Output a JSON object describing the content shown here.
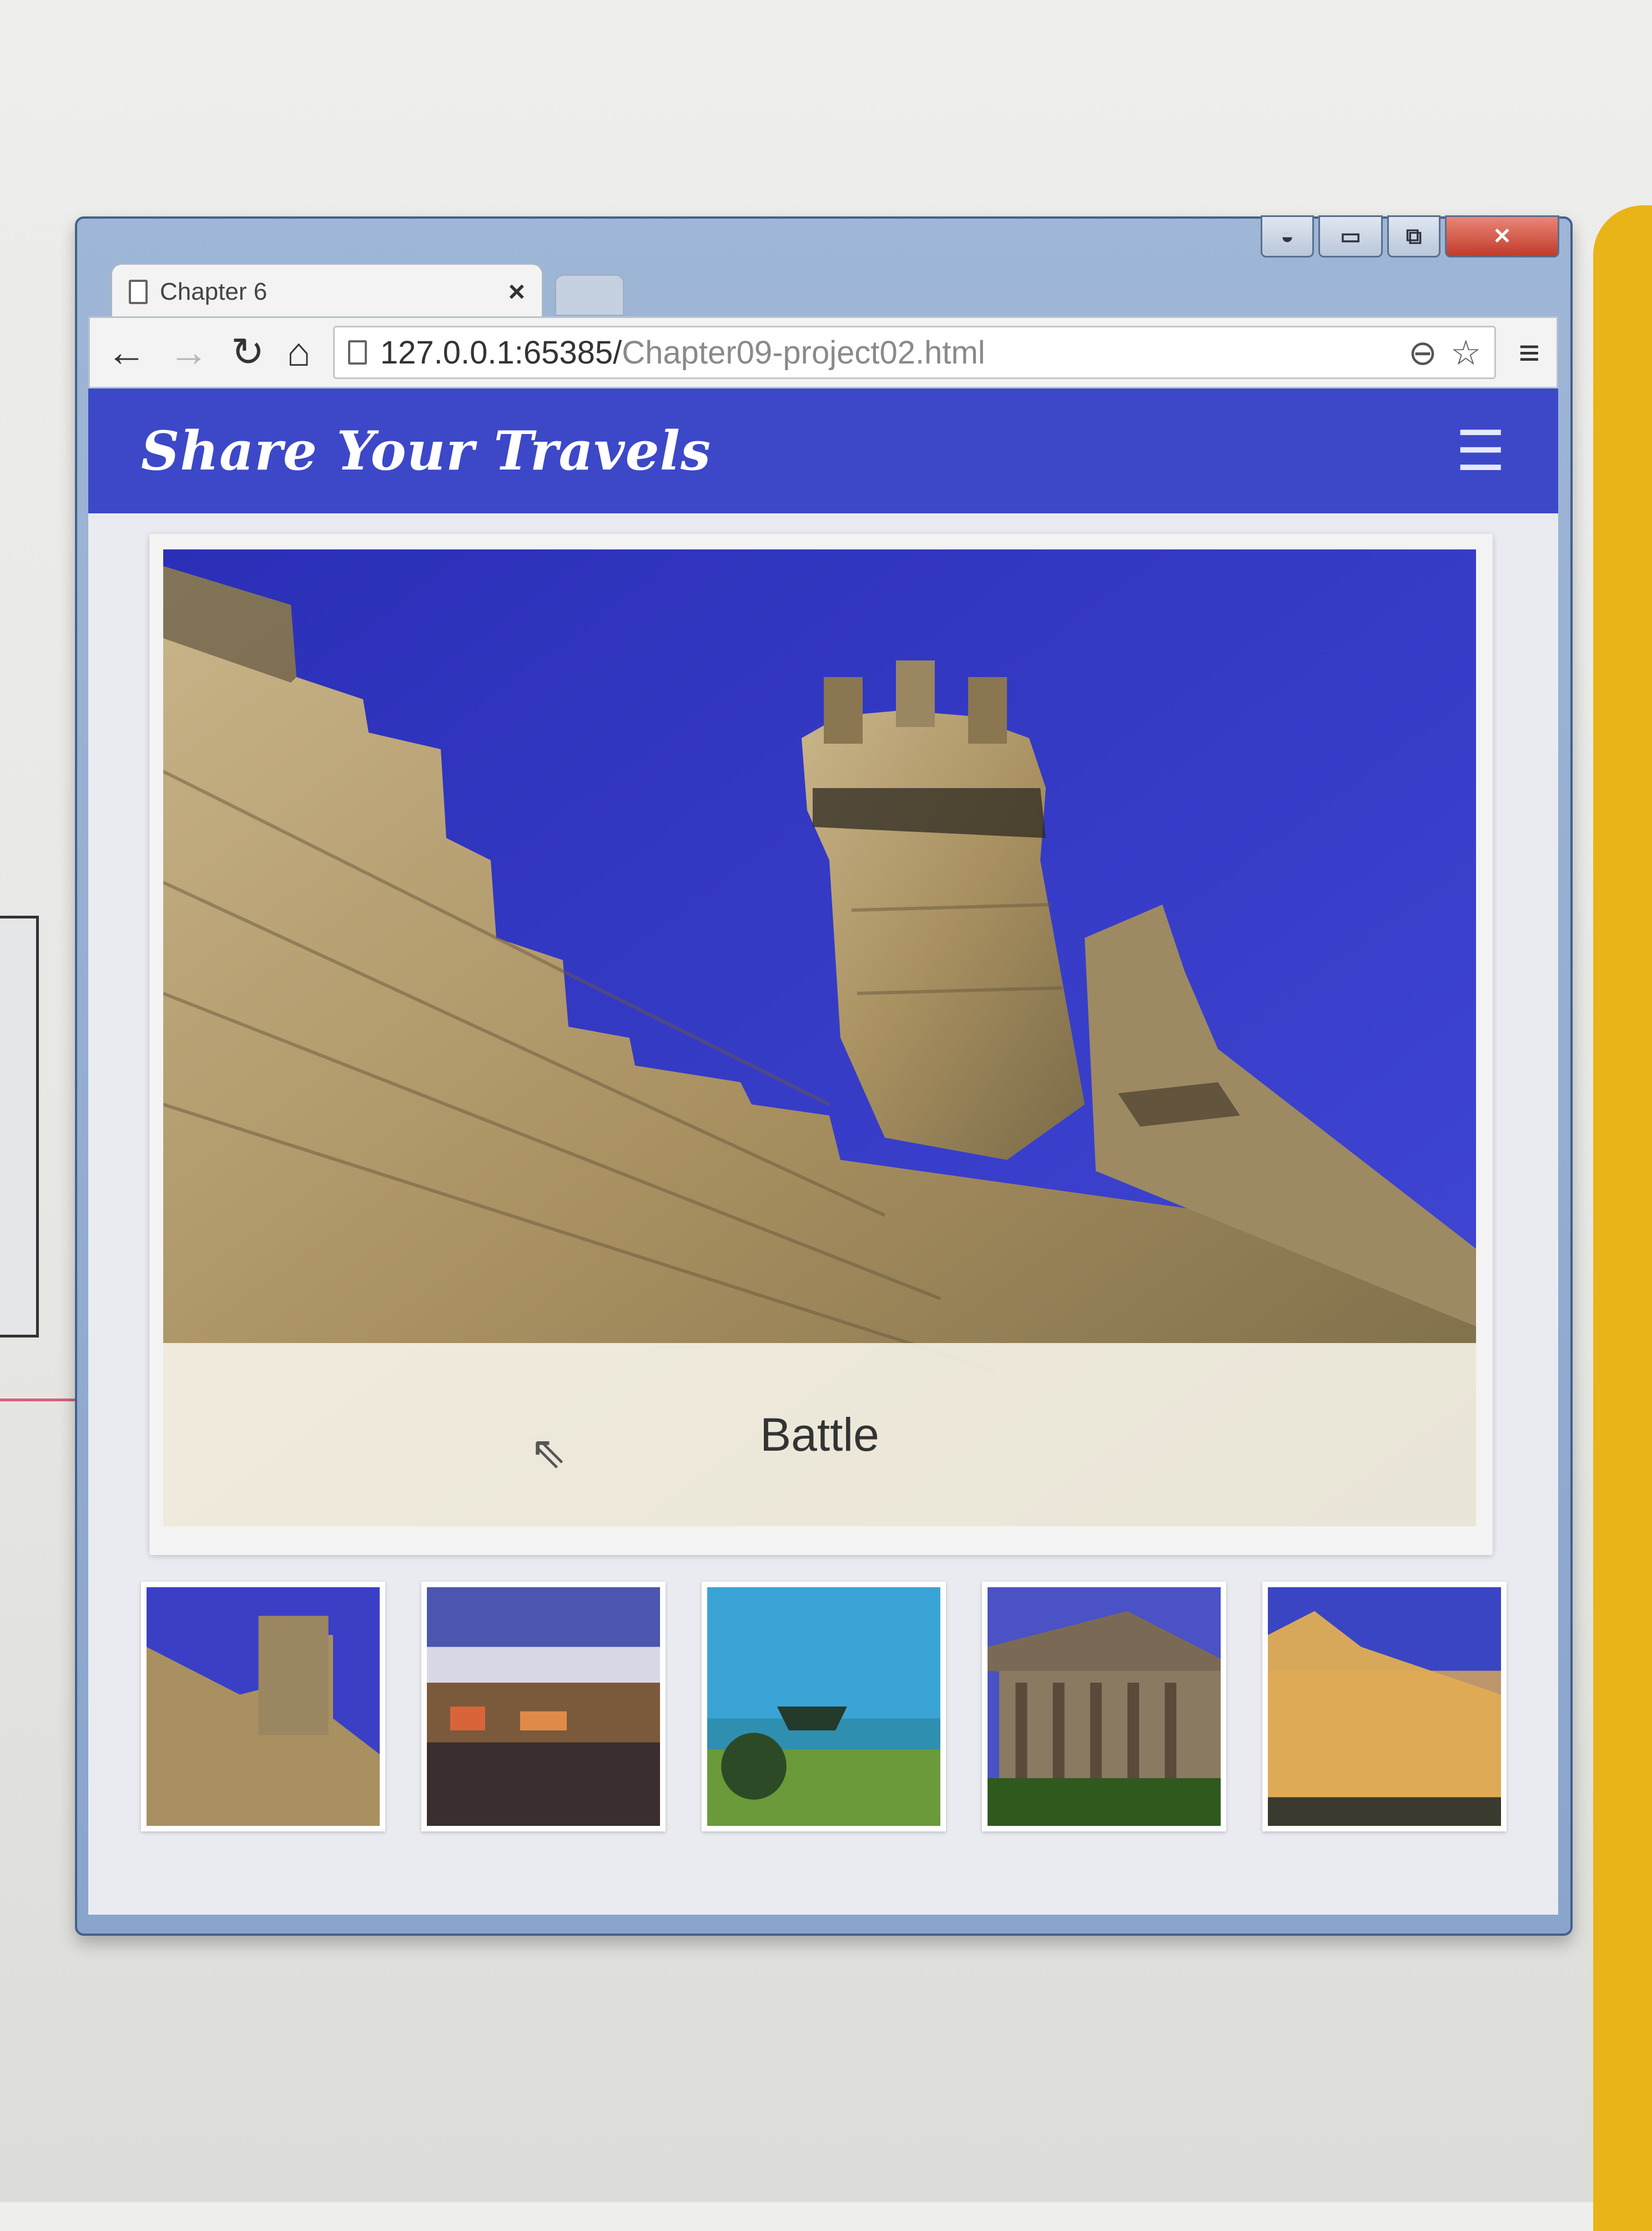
{
  "browser": {
    "tab_title": "Chapter 6",
    "tab_close": "×",
    "url_host": "127.0.0.1:65385/",
    "url_path": "Chapter09-project02.html",
    "back_icon": "back-arrow-icon",
    "forward_icon": "forward-arrow-icon",
    "reload_icon": "reload-icon",
    "home_icon": "home-icon"
  },
  "app": {
    "brand": "Share Your Travels",
    "menu_icon": "hamburger-menu-icon"
  },
  "hero": {
    "caption": "Battle"
  },
  "thumbnails": [
    {
      "subject": "castle tower"
    },
    {
      "subject": "harbour town"
    },
    {
      "subject": "ship at sea"
    },
    {
      "subject": "greek temple"
    },
    {
      "subject": "palace building"
    }
  ],
  "colors": {
    "appbar": "#3c48c8",
    "sky": "#3a3fc6"
  }
}
